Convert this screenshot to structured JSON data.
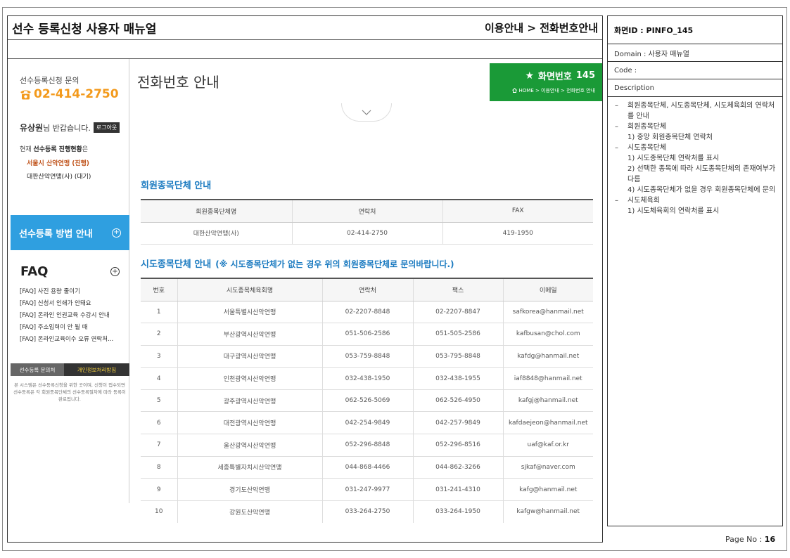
{
  "header": {
    "title": "선수 등록신청 사용자 매뉴얼",
    "location": "이용안내 > 전화번호안내"
  },
  "sidebar": {
    "inquiry_label": "선수등록신청 문의",
    "phone": "02-414-2750",
    "user_name": "유상원",
    "greeting": "님 반갑습니다.",
    "logout_label": "로그아웃",
    "status_prefix": "현재 ",
    "status_bold": "선수등록 진행현황",
    "status_suffix": "은",
    "status_items": [
      "서울시 산악연맹 (진행)",
      "대판산악연맹(사) (대기)"
    ],
    "menu_label": "선수등록 방법 안내",
    "faq_title": "FAQ",
    "faq_items": [
      "[FAQ]  사진 용량 줄이기",
      "[FAQ]  신청서 인쇄가 안돼요",
      "[FAQ]  온라인 인권교육 수강시 안내",
      "[FAQ]  주소입력이 안 될 때",
      "[FAQ]  온라인교육이수 오류 연락처..."
    ],
    "bottom_left": "선수등록 문의처",
    "bottom_right": "개인정보처리방침",
    "note": "본 시스템은 선수등록신청을 위한 곳이며, 신청이 접수되면 선수등록은 각 회원종목단체의 선수등록절차에 따라 등록이 완료됩니다."
  },
  "content": {
    "page_title": "전화번호 안내",
    "badge_number_label": "화면번호",
    "badge_number": "145",
    "badge_breadcrumb": "HOME > 이용안내 > 전화번호 안내",
    "section1_title": "회원종목단체 안내",
    "table1": {
      "headers": [
        "회원종목단체명",
        "연락처",
        "FAX"
      ],
      "rows": [
        [
          "대한산악연맹(사)",
          "02-414-2750",
          "419-1950"
        ]
      ]
    },
    "section2_title": "시도종목단체 안내",
    "section2_note": "(※ 시도종목단체가 없는 경우 위의 회원종목단체로 문의바랍니다.)",
    "table2": {
      "headers": [
        "번호",
        "시도종목체육회명",
        "연락처",
        "팩스",
        "이메일"
      ],
      "rows": [
        [
          "1",
          "서울특별시산악연맹",
          "02-2207-8848",
          "02-2207-8847",
          "safkorea@hanmail.net"
        ],
        [
          "2",
          "부산광역시산악연맹",
          "051-506-2586",
          "051-505-2586",
          "kafbusan@chol.com"
        ],
        [
          "3",
          "대구광역시산악연맹",
          "053-759-8848",
          "053-795-8848",
          "kafdg@hanmail.net"
        ],
        [
          "4",
          "인천광역시산악연맹",
          "032-438-1950",
          "032-438-1955",
          "iaf8848@hanmail.net"
        ],
        [
          "5",
          "광주광역시산악연맹",
          "062-526-5069",
          "062-526-4950",
          "kafgj@hanmail.net"
        ],
        [
          "6",
          "대전광역시산악연맹",
          "042-254-9849",
          "042-257-9849",
          "kafdaejeon@hanmail.net"
        ],
        [
          "7",
          "울산광역시산악연맹",
          "052-296-8848",
          "052-296-8516",
          "uaf@kaf.or.kr"
        ],
        [
          "8",
          "세종특별자치시산악연맹",
          "044-868-4466",
          "044-862-3266",
          "sjkaf@naver.com"
        ],
        [
          "9",
          "경기도산악연맹",
          "031-247-9977",
          "031-241-4310",
          "kafg@hanmail.net"
        ],
        [
          "10",
          "강원도산악연맹",
          "033-264-2750",
          "033-264-1950",
          "kafgw@hanmail.net"
        ]
      ]
    }
  },
  "panel": {
    "screen_id": "화면ID : PINFO_145",
    "domain": "Domain : 사용자 매뉴얼",
    "code": "Code :",
    "description_label": "Description",
    "description": [
      {
        "level": 0,
        "text": "회원종목단체, 시도종목단체, 시도체육회의 연락처를 안내"
      },
      {
        "level": 0,
        "text": "회원종목단체"
      },
      {
        "level": 1,
        "text": "1) 중앙 회원종목단체 연락처"
      },
      {
        "level": 0,
        "text": "시도종목단체"
      },
      {
        "level": 1,
        "text": "1) 시도종목단체 연락처를 표시"
      },
      {
        "level": 1,
        "text": "2) 선택한 종목에 따라 시도종목단체의 존재여부가 다름"
      },
      {
        "level": 1,
        "text": "4) 시도종목단체가 없을 경우 회원종목단체에 문의"
      },
      {
        "level": 0,
        "text": "시도체육회"
      },
      {
        "level": 1,
        "text": "1) 시도체육회의 연락처를 표시"
      }
    ]
  },
  "footer": {
    "page_label": "Page No : ",
    "page_number": "16"
  },
  "colors": {
    "accent_orange": "#f39a1c",
    "menu_blue": "#2f9fe0",
    "badge_green": "#1a9a37",
    "section_blue": "#1a7ac0"
  }
}
